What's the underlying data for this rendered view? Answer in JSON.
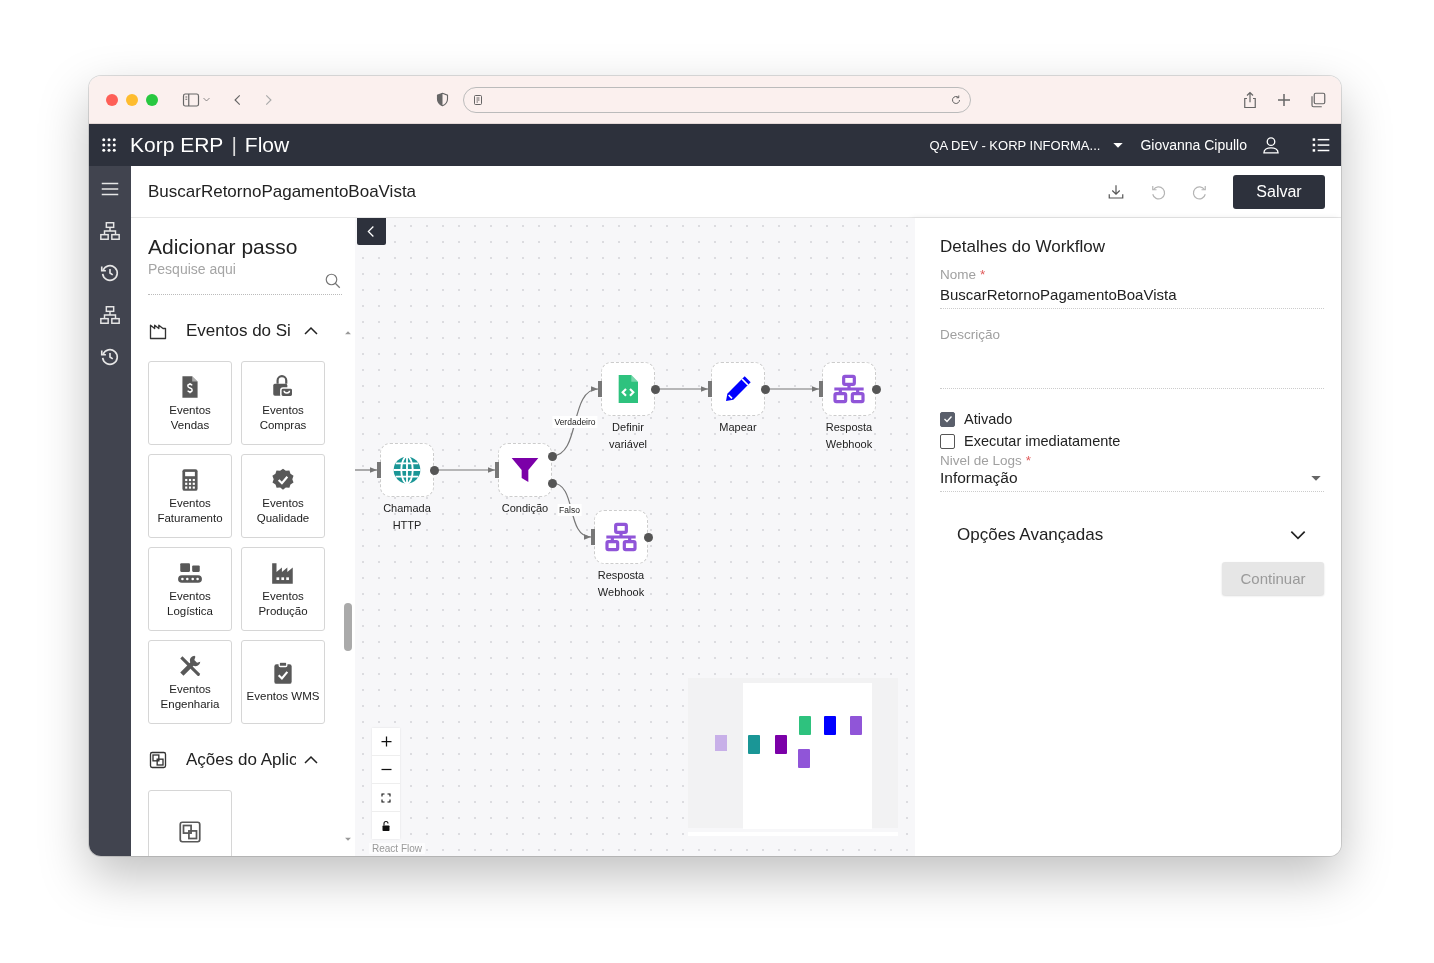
{
  "app_header": {
    "brand": "Korp ERP",
    "separator": "|",
    "module": "Flow",
    "environment": "QA DEV - KORP INFORMA...",
    "user": "Giovanna Cipullo"
  },
  "title_bar": {
    "workflow_title": "BuscarRetornoPagamentoBoaVista",
    "undo_disabled": true,
    "redo_disabled": true,
    "save_label": "Salvar"
  },
  "step_panel": {
    "title": "Adicionar passo",
    "search": {
      "placeholder": "Pesquise aqui"
    },
    "sections": [
      {
        "kind": "system",
        "title": "Eventos do Si",
        "expanded": true,
        "items": [
          {
            "kind": "sales",
            "label": "Eventos Vendas"
          },
          {
            "kind": "purchases",
            "label": "Eventos Compras"
          },
          {
            "kind": "billing",
            "label": "Eventos Faturamento"
          },
          {
            "kind": "quality",
            "label": "Eventos Qualidade"
          },
          {
            "kind": "logistics",
            "label": "Eventos Logística"
          },
          {
            "kind": "production",
            "label": "Eventos Produção"
          },
          {
            "kind": "engineering",
            "label": "Eventos Engenharia"
          },
          {
            "kind": "wms",
            "label": "Eventos WMS"
          }
        ]
      },
      {
        "kind": "app",
        "title": "Ações do Aplic",
        "expanded": true,
        "items": [
          {
            "kind": "app-actions"
          }
        ]
      }
    ]
  },
  "canvas": {
    "nodes": [
      {
        "kind": "http",
        "label": "Chamada HTTP"
      },
      {
        "kind": "condition",
        "label": "Condição"
      },
      {
        "kind": "variable",
        "label": "Definir variável"
      },
      {
        "kind": "map",
        "label": "Mapear"
      },
      {
        "kind": "webhook",
        "label": "Resposta Webhook"
      },
      {
        "kind": "webhook",
        "label": "Resposta Webhook"
      }
    ],
    "branch_labels": [
      {
        "kind": "true",
        "label": "Verdadeiro"
      },
      {
        "kind": "false",
        "label": "Falso"
      }
    ],
    "attribution": "React Flow"
  },
  "details": {
    "title": "Detalhes do Workflow",
    "name_field": {
      "label": "Nome",
      "required_mark": "*",
      "value": "BuscarRetornoPagamentoBoaVista"
    },
    "description_field": {
      "label": "Descrição"
    },
    "checkboxes": [
      {
        "label": "Ativado",
        "checked": true
      },
      {
        "label": "Executar imediatamente",
        "checked": false
      }
    ],
    "log_level": {
      "label": "Nivel de Logs",
      "required_mark": "*",
      "value": "Informação"
    },
    "advanced": {
      "title": "Opções Avançadas",
      "expanded": false
    },
    "continue_button": {
      "label": "Continuar",
      "disabled": true
    }
  }
}
